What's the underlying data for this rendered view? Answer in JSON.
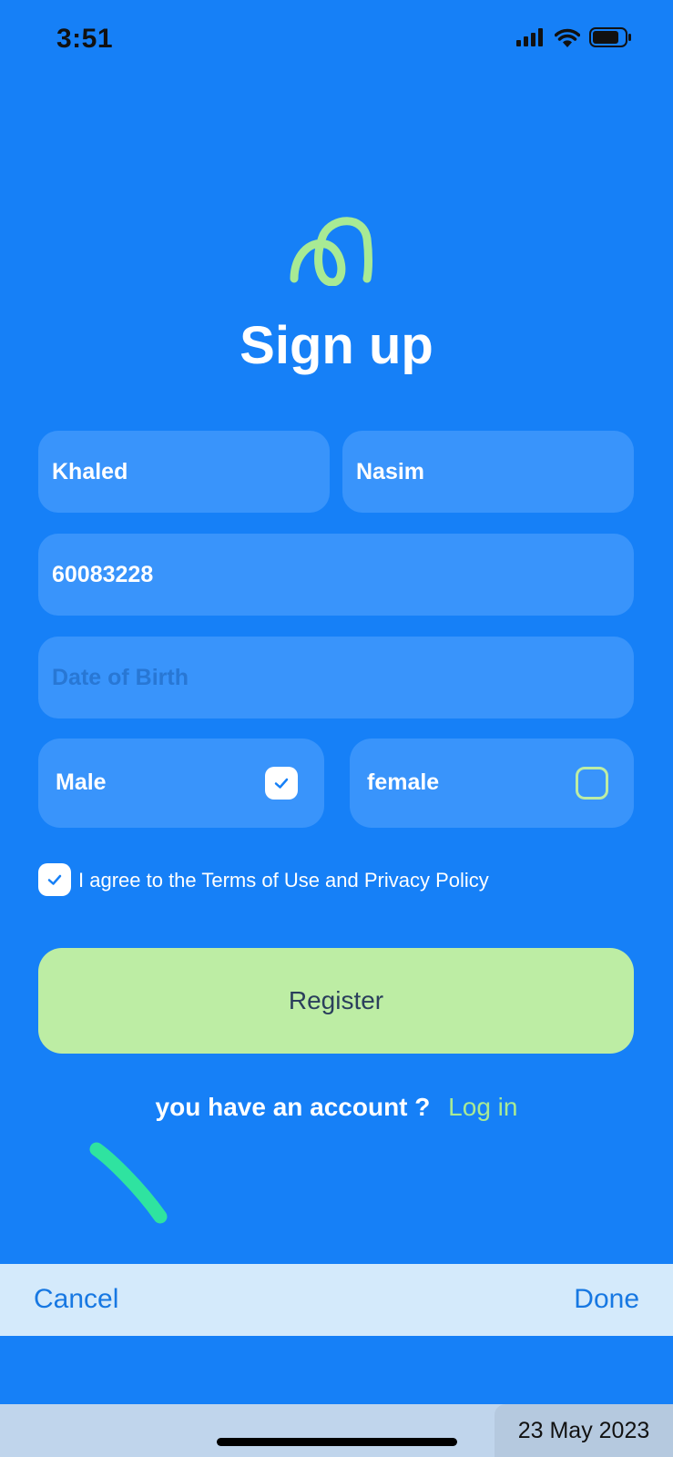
{
  "status_bar": {
    "time": "3:51",
    "icons": [
      "signal-icon",
      "wifi-icon",
      "battery-icon"
    ]
  },
  "logo": {
    "icon": "loop-logo-icon",
    "color": "#A8EA94"
  },
  "title": "Sign up",
  "form": {
    "first_name": {
      "value": "Khaled",
      "placeholder": ""
    },
    "last_name": {
      "value": "Nasim",
      "placeholder": ""
    },
    "phone": {
      "value": "60083228",
      "placeholder": ""
    },
    "dob": {
      "value": "",
      "placeholder": "Date of Birth"
    },
    "gender": {
      "male_label": "Male",
      "female_label": "female",
      "selected": "Male"
    },
    "agree_text": "I agree to the Terms of Use and Privacy Policy",
    "agree_checked": true,
    "register_label": "Register"
  },
  "account_prompt": {
    "text": "you have an account ?",
    "login_label": "Log in"
  },
  "picker_toolbar": {
    "cancel_label": "Cancel",
    "done_label": "Done"
  },
  "date_picker": {
    "value": "23 May 2023"
  },
  "colors": {
    "background": "#1680F7",
    "field": "#3994FB",
    "accent": "#BDEDA4",
    "link": "#A8EA94",
    "toolbar": "#D4EAFB",
    "toolbar_text": "#1778E2"
  }
}
